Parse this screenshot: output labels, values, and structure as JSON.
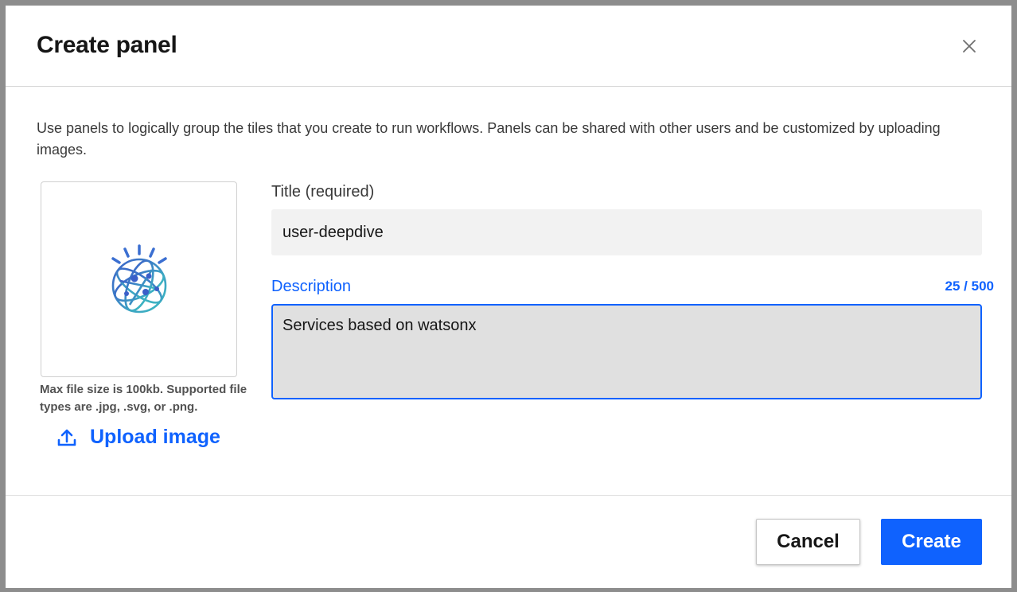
{
  "modal": {
    "title": "Create panel",
    "close_icon": "close-icon",
    "intro": "Use panels to logically group the tiles that you create to run workflows. Panels can be shared with other users and be customized by uploading images."
  },
  "image_section": {
    "preview_icon": "watson-globe-icon",
    "file_note": "Max file size is 100kb. Supported file types are .jpg, .svg, or .png.",
    "upload_icon": "upload-icon",
    "upload_label": "Upload image"
  },
  "form": {
    "title_label": "Title (required)",
    "title_value": "user-deepdive",
    "description_label": "Description",
    "description_counter": "25 / 500",
    "description_value": "Services based on watsonx"
  },
  "footer": {
    "cancel_label": "Cancel",
    "create_label": "Create"
  },
  "colors": {
    "primary": "#0f62fe",
    "text": "#161616",
    "input_bg": "#f2f2f2",
    "textarea_bg": "#e0e0e0"
  }
}
